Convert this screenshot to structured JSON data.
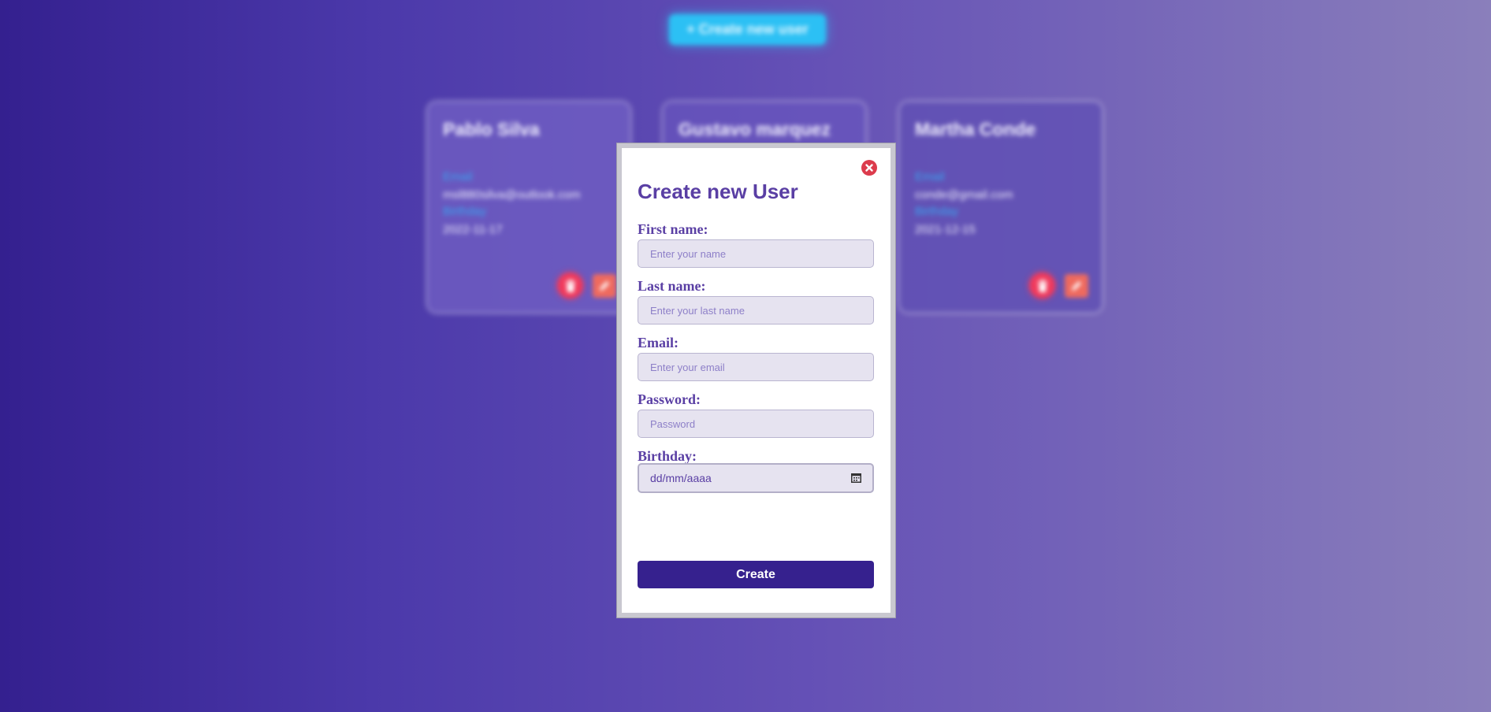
{
  "page": {
    "create_button_label": "+ Create new user"
  },
  "users": [
    {
      "name": "Pablo Silva",
      "email_label": "Email",
      "email": "msl880silva@outlook.com",
      "birthday_label": "Birthday",
      "birthday": "2022-11-17"
    },
    {
      "name": "Gustavo marquez",
      "email_label": "",
      "email": "",
      "birthday_label": "",
      "birthday": ""
    },
    {
      "name": "Martha Conde",
      "email_label": "Email",
      "email": "conde@gmail.com",
      "birthday_label": "Birthday",
      "birthday": "2021-12-15"
    }
  ],
  "modal": {
    "title": "Create new User",
    "fields": {
      "first_name": {
        "label": "First name:",
        "placeholder": "Enter your name"
      },
      "last_name": {
        "label": "Last name:",
        "placeholder": "Enter your last name"
      },
      "email": {
        "label": "Email:",
        "placeholder": "Enter your email"
      },
      "password": {
        "label": "Password:",
        "placeholder": "Password"
      },
      "birthday": {
        "label": "Birthday:",
        "value": "dd/mm/aaaa"
      }
    },
    "submit_label": "Create"
  },
  "icons": {
    "close": "close-circle-icon",
    "delete": "trash-icon",
    "edit": "pencil-icon",
    "calendar": "calendar-icon"
  },
  "colors": {
    "accent": "#5a3fa4",
    "primary_button": "#36218e",
    "create_button": "#2cc0f4",
    "delete": "#f03a5c",
    "edit": "#ef6a5e",
    "close": "#dc3b4c",
    "card_label": "#38a6f0"
  }
}
